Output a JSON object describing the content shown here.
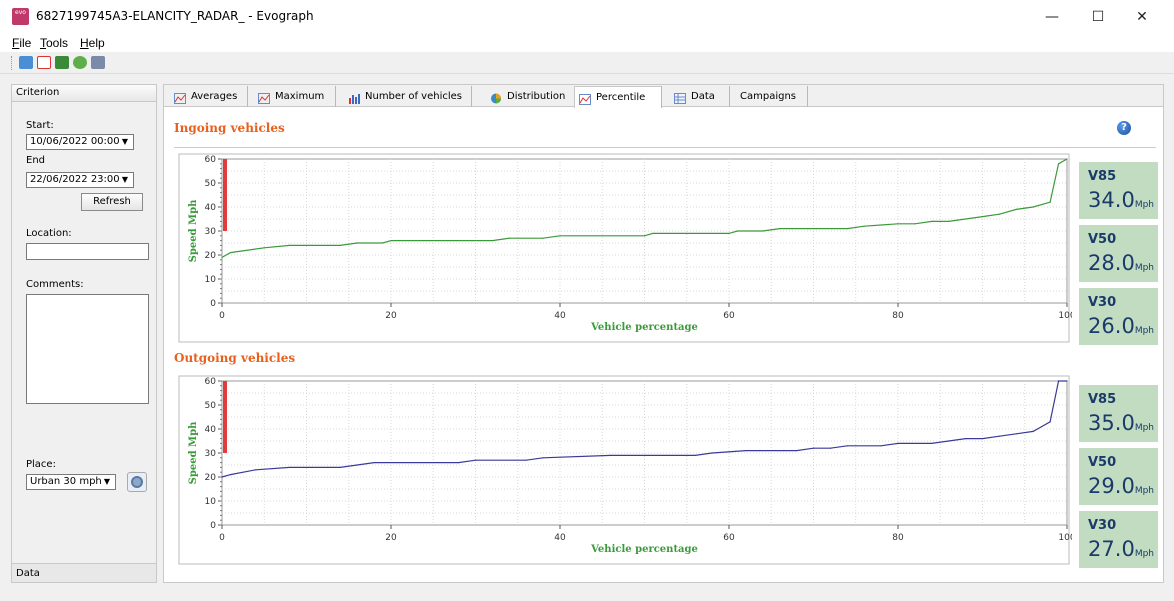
{
  "window": {
    "title": "6827199745A3-ELANCITY_RADAR_ - Evograph",
    "app_icon_text": "evo",
    "minimize_glyph": "—",
    "maximize_glyph": "☐",
    "close_glyph": "✕"
  },
  "menu": [
    {
      "accel": "F",
      "rest": "ile"
    },
    {
      "accel": "T",
      "rest": "ools"
    },
    {
      "accel": "H",
      "rest": "elp"
    }
  ],
  "toolbar_icons": [
    "folder-open-icon",
    "pdf-icon",
    "image-export-icon",
    "refresh-icon",
    "print-icon"
  ],
  "criterion": {
    "header": "Criterion",
    "start_label": "Start:",
    "start_value": "10/06/2022 00:00",
    "end_label": "End",
    "end_value": "22/06/2022 23:00",
    "refresh_label": "Refresh",
    "location_label": "Location:",
    "location_value": "",
    "comments_label": "Comments:",
    "comments_value": "",
    "place_label": "Place:",
    "place_value": "Urban 30 mph",
    "footer": "Data",
    "dropdown_glyph": "▼"
  },
  "tabs": [
    {
      "label": "Averages",
      "icon": "line-chart-icon",
      "active": false
    },
    {
      "label": "Maximum",
      "icon": "line-chart-icon",
      "active": false
    },
    {
      "label": "Number of vehicles",
      "icon": "bar-chart-icon",
      "active": false
    },
    {
      "label": "Distribution",
      "icon": "pie-chart-icon",
      "active": false
    },
    {
      "label": "Percentile",
      "icon": "line-chart-icon",
      "active": true
    },
    {
      "label": "Data",
      "icon": "table-icon",
      "active": false
    },
    {
      "label": "Campaigns",
      "icon": "",
      "active": false
    }
  ],
  "help_glyph": "?",
  "sections": {
    "ingoing": {
      "title": "Ingoing vehicles",
      "stats": [
        {
          "label": "V85",
          "value": "34.0",
          "unit": "Mph"
        },
        {
          "label": "V50",
          "value": "28.0",
          "unit": "Mph"
        },
        {
          "label": "V30",
          "value": "26.0",
          "unit": "Mph"
        }
      ]
    },
    "outgoing": {
      "title": "Outgoing vehicles",
      "stats": [
        {
          "label": "V85",
          "value": "35.0",
          "unit": "Mph"
        },
        {
          "label": "V50",
          "value": "29.0",
          "unit": "Mph"
        },
        {
          "label": "V30",
          "value": "27.0",
          "unit": "Mph"
        }
      ]
    }
  },
  "chart_data": [
    {
      "type": "line",
      "title": "Ingoing vehicles",
      "xlabel": "Vehicle percentage",
      "ylabel": "Speed Mph",
      "xlim": [
        0,
        100
      ],
      "ylim": [
        0,
        60
      ],
      "xticks": [
        0,
        20,
        40,
        60,
        80,
        100
      ],
      "yticks": [
        0,
        10,
        20,
        30,
        40,
        50,
        60
      ],
      "grid": true,
      "color": "#3a9a3a",
      "x": [
        0,
        1,
        5,
        8,
        14,
        16,
        19,
        20,
        32,
        34,
        38,
        40,
        50,
        51,
        60,
        61,
        64,
        66,
        74,
        76,
        80,
        82,
        84,
        86,
        90,
        92,
        94,
        96,
        98,
        99,
        100
      ],
      "y": [
        19,
        21,
        23,
        24,
        24,
        25,
        25,
        26,
        26,
        27,
        27,
        28,
        28,
        29,
        29,
        30,
        30,
        31,
        31,
        32,
        33,
        33,
        34,
        34,
        36,
        37,
        39,
        40,
        42,
        58,
        60
      ]
    },
    {
      "type": "line",
      "title": "Outgoing vehicles",
      "xlabel": "Vehicle percentage",
      "ylabel": "Speed Mph",
      "xlim": [
        0,
        100
      ],
      "ylim": [
        0,
        60
      ],
      "xticks": [
        0,
        20,
        40,
        60,
        80,
        100
      ],
      "yticks": [
        0,
        10,
        20,
        30,
        40,
        50,
        60
      ],
      "grid": true,
      "color": "#3a3a9a",
      "x": [
        0,
        1,
        4,
        8,
        14,
        16,
        18,
        28,
        30,
        36,
        38,
        46,
        56,
        58,
        62,
        68,
        70,
        72,
        74,
        78,
        80,
        84,
        86,
        88,
        90,
        92,
        94,
        96,
        97,
        98,
        99,
        100
      ],
      "y": [
        20,
        21,
        23,
        24,
        24,
        25,
        26,
        26,
        27,
        27,
        28,
        29,
        29,
        30,
        31,
        31,
        32,
        32,
        33,
        33,
        34,
        34,
        35,
        36,
        36,
        37,
        38,
        39,
        41,
        43,
        60,
        60
      ]
    }
  ]
}
